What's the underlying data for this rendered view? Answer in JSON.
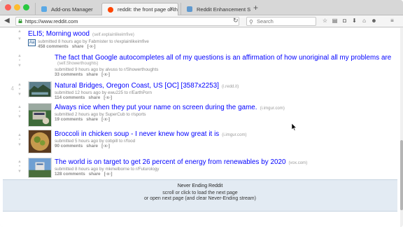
{
  "browser": {
    "tabs": [
      {
        "title": "Add-ons Manager",
        "color": "#5aa9e6"
      },
      {
        "title": "reddit: the front page of th...",
        "color": "#ff4500",
        "active": true
      },
      {
        "title": "Reddit Enhancement Suite",
        "color": "#5f99cf"
      }
    ],
    "url": "https://www.reddit.com",
    "search_placeholder": "Search"
  },
  "posts": [
    {
      "title": "ELI5; Morning wood",
      "domain": "(self.explainlikeimfive)",
      "tagline": "submitted 8 hours ago by Fabmister to r/explainlikeimfive",
      "comments": "458 comments",
      "share": "share",
      "hide": "[-x-]",
      "self": true
    },
    {
      "title": "The fact that Google autocompletes all of my questions is an affirmation of how unoriginal all my problems are",
      "domain": "(self.Showerthoughts)",
      "tagline": "submitted 9 hours ago by alvuss to r/Showerthoughts",
      "comments": "33 comments",
      "share": "share",
      "hide": "[-x-]"
    },
    {
      "title": "Natural Bridges, Oregon Coast, US [OC] [3587x2253]",
      "domain": "(i.redd.it)",
      "tagline": "submitted 12 hours ago by ewu225 to r/EarthPorn",
      "comments": "114 comments",
      "share": "share",
      "hide": "[-x-]"
    },
    {
      "title": "Always nice when they put your name on screen during the game.",
      "domain": "(i.imgur.com)",
      "tagline": "submitted 2 hours ago by SuperCub to r/sports",
      "comments": "19 comments",
      "share": "share",
      "hide": "[-x-]"
    },
    {
      "title": "Broccoli in chicken soup - I never knew how great it is",
      "domain": "(i.imgur.com)",
      "tagline": "submitted 5 hours ago by cobpill to r/food",
      "comments": "90 comments",
      "share": "share",
      "hide": "[-x-]"
    },
    {
      "title": "The world is on target to get 26 percent of energy from renewables by 2020",
      "domain": "(vox.com)",
      "tagline": "submitted 8 hours ago by mkmelborne to r/Futurology",
      "comments": "128 comments",
      "share": "share",
      "hide": "[-x-]"
    }
  ],
  "ner": {
    "heading": "Never Ending Reddit",
    "line1": "scroll or click to load the next page",
    "line2": "or open next page (and clear Never-Ending stream)"
  }
}
